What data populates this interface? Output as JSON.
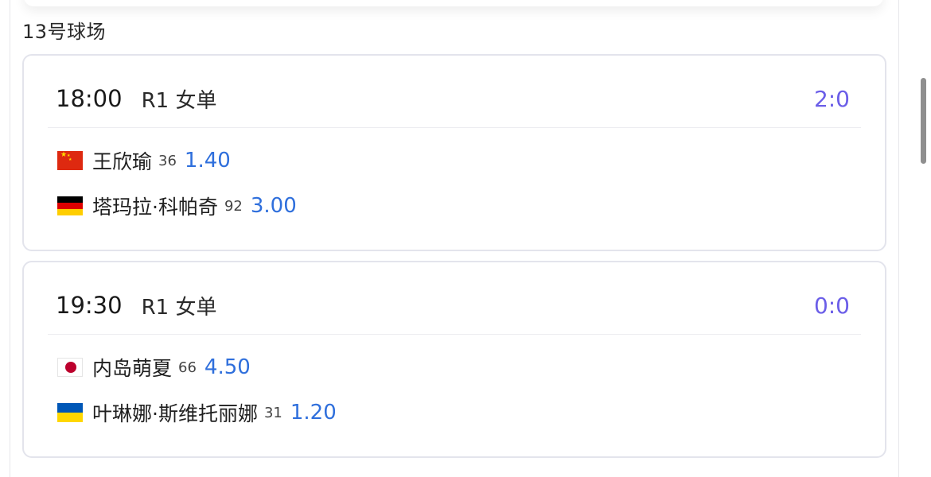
{
  "venue": "13号球场",
  "matches": [
    {
      "time": "18:00",
      "round": "R1 女单",
      "score": "2:0",
      "players": [
        {
          "flag": "china-flag",
          "name": "王欣瑜",
          "rank": "36",
          "odds": "1.40"
        },
        {
          "flag": "germany-flag",
          "name": "塔玛拉·科帕奇",
          "rank": "92",
          "odds": "3.00"
        }
      ]
    },
    {
      "time": "19:30",
      "round": "R1 女单",
      "score": "0:0",
      "players": [
        {
          "flag": "japan-flag",
          "name": "内岛萌夏",
          "rank": "66",
          "odds": "4.50"
        },
        {
          "flag": "ukraine-flag",
          "name": "叶琳娜·斯维托丽娜",
          "rank": "31",
          "odds": "1.20"
        }
      ]
    }
  ],
  "colors": {
    "score": "#6b5ee8",
    "odds": "#2f6fdc"
  }
}
